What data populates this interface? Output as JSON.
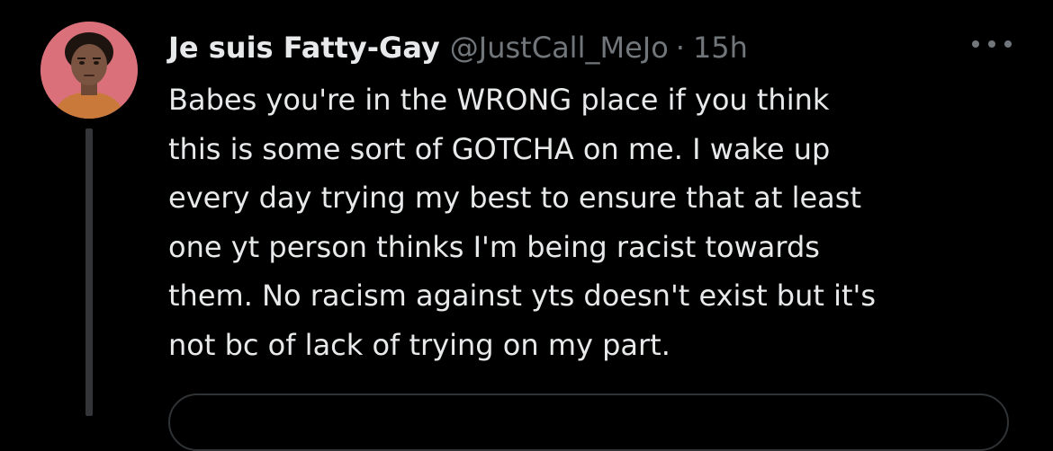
{
  "tweet": {
    "display_name": "Je suis Fatty-Gay",
    "handle": "@JustCall_MeJo",
    "separator": "·",
    "time": "15h",
    "body_lines": [
      "Babes you're in the WRONG place if you think",
      "this is some sort of GOTCHA on me. I wake up",
      "every day trying my best to ensure that at least",
      "one yt person thinks I'm being racist towards",
      "them. No racism against yts doesn't exist but it's",
      "not bc of lack of trying on my part."
    ],
    "avatar_icon": "cartoon-person-avatar",
    "more_icon": "more-horizontal-icon"
  },
  "colors": {
    "background": "#000000",
    "primary_text": "#e7e9ea",
    "secondary_text": "#71767b",
    "thread_line": "#333639",
    "avatar_bg": "#d9707a"
  }
}
